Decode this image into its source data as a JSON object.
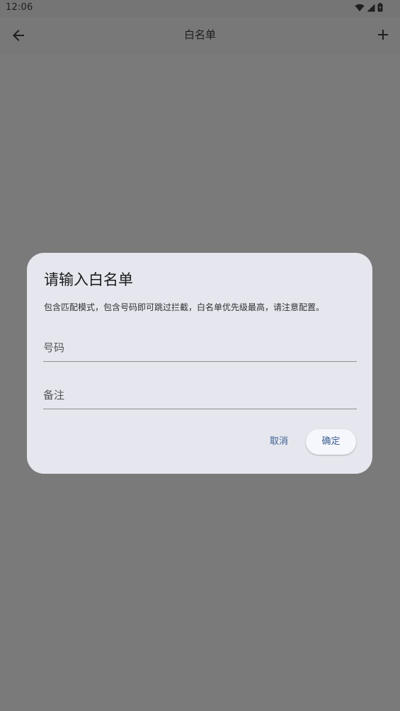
{
  "status_bar": {
    "time": "12:06",
    "icons": [
      "wifi-icon",
      "cellular-signal-icon",
      "battery-icon"
    ]
  },
  "app_bar": {
    "title": "白名单",
    "back_icon": "arrow-left-icon",
    "add_icon": "plus-icon"
  },
  "dialog": {
    "title": "请输入白名单",
    "message": "包含匹配模式，包含号码即可跳过拦截，白名单优先级最高，请注意配置。",
    "number_field": {
      "value": "",
      "placeholder": "号码"
    },
    "remark_field": {
      "value": "",
      "placeholder": "备注"
    },
    "cancel_label": "取消",
    "confirm_label": "确定"
  },
  "colors": {
    "scrim": "#7a7a7b",
    "dialog_surface": "#e6e7ee",
    "primary_text_button": "#3c5f91"
  }
}
